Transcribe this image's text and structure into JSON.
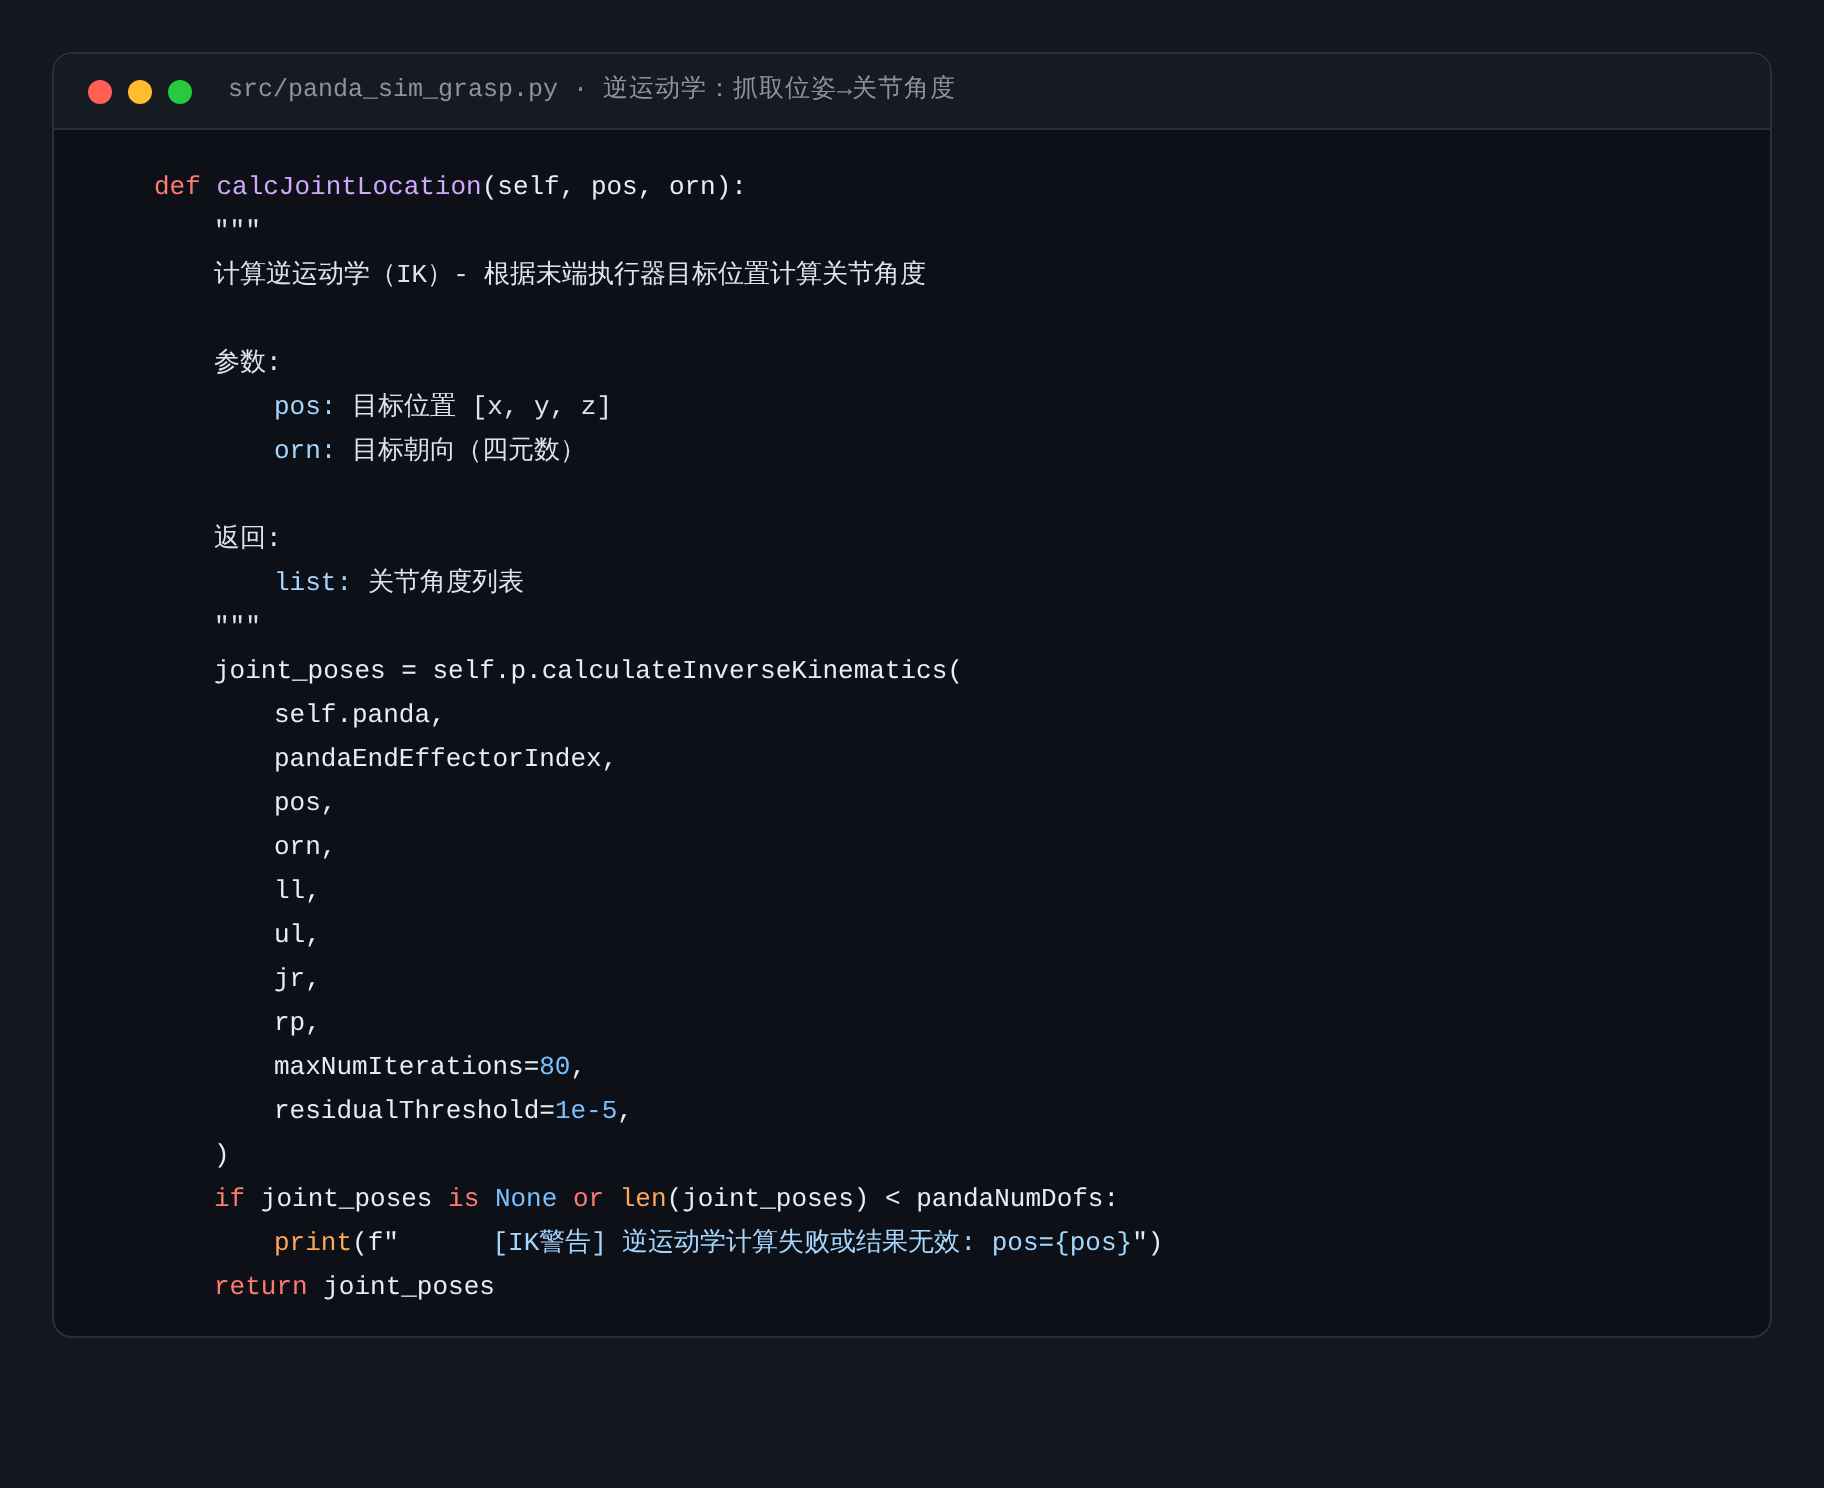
{
  "window": {
    "title": "src/panda_sim_grasp.py · 逆运动学：抓取位姿→关节角度"
  },
  "code": [
    {
      "kind": "code",
      "tokens": [
        {
          "kind": "kw",
          "text": "def "
        },
        {
          "kind": "fn",
          "text": "calcJointLocation"
        },
        {
          "kind": "plain",
          "text": "(self, pos, orn):"
        }
      ],
      "children": [
        {
          "kind": "code",
          "tokens": [
            {
              "kind": "doc",
              "text": "\"\"\""
            }
          ]
        },
        {
          "kind": "code",
          "tokens": [
            {
              "kind": "doc",
              "text": "计算逆运动学（IK）- 根据末端执行器目标位置计算关节角度"
            }
          ]
        },
        {
          "kind": "blank"
        },
        {
          "kind": "code",
          "tokens": [
            {
              "kind": "doc",
              "text": "参数:"
            }
          ],
          "children": [
            {
              "kind": "code",
              "tokens": [
                {
                  "kind": "param",
                  "text": "pos:"
                },
                {
                  "kind": "doc",
                  "text": " 目标位置 [x, y, z]"
                }
              ]
            },
            {
              "kind": "code",
              "tokens": [
                {
                  "kind": "param",
                  "text": "orn:"
                },
                {
                  "kind": "doc",
                  "text": " 目标朝向（四元数）"
                }
              ]
            }
          ]
        },
        {
          "kind": "blank"
        },
        {
          "kind": "code",
          "tokens": [
            {
              "kind": "doc",
              "text": "返回:"
            }
          ],
          "children": [
            {
              "kind": "code",
              "tokens": [
                {
                  "kind": "param",
                  "text": "list:"
                },
                {
                  "kind": "doc",
                  "text": " 关节角度列表"
                }
              ]
            }
          ]
        },
        {
          "kind": "code",
          "tokens": [
            {
              "kind": "doc",
              "text": "\"\"\""
            }
          ]
        },
        {
          "kind": "code",
          "tokens": [
            {
              "kind": "plain",
              "text": "joint_poses = self.p.calculateInverseKinematics("
            }
          ],
          "children": [
            {
              "kind": "code",
              "tokens": [
                {
                  "kind": "plain",
                  "text": "self.panda,"
                }
              ]
            },
            {
              "kind": "code",
              "tokens": [
                {
                  "kind": "plain",
                  "text": "pandaEndEffectorIndex,"
                }
              ]
            },
            {
              "kind": "code",
              "tokens": [
                {
                  "kind": "plain",
                  "text": "pos,"
                }
              ]
            },
            {
              "kind": "code",
              "tokens": [
                {
                  "kind": "plain",
                  "text": "orn,"
                }
              ]
            },
            {
              "kind": "code",
              "tokens": [
                {
                  "kind": "plain",
                  "text": "ll,"
                }
              ]
            },
            {
              "kind": "code",
              "tokens": [
                {
                  "kind": "plain",
                  "text": "ul,"
                }
              ]
            },
            {
              "kind": "code",
              "tokens": [
                {
                  "kind": "plain",
                  "text": "jr,"
                }
              ]
            },
            {
              "kind": "code",
              "tokens": [
                {
                  "kind": "plain",
                  "text": "rp,"
                }
              ]
            },
            {
              "kind": "code",
              "tokens": [
                {
                  "kind": "plain",
                  "text": "maxNumIterations="
                },
                {
                  "kind": "num",
                  "text": "80"
                },
                {
                  "kind": "plain",
                  "text": ","
                }
              ]
            },
            {
              "kind": "code",
              "tokens": [
                {
                  "kind": "plain",
                  "text": "residualThreshold="
                },
                {
                  "kind": "num",
                  "text": "1e-5"
                },
                {
                  "kind": "plain",
                  "text": ","
                }
              ]
            }
          ]
        },
        {
          "kind": "code",
          "tokens": [
            {
              "kind": "plain",
              "text": ")"
            }
          ]
        },
        {
          "kind": "code",
          "tokens": [
            {
              "kind": "kw",
              "text": "if"
            },
            {
              "kind": "plain",
              "text": " joint_poses "
            },
            {
              "kind": "kw",
              "text": "is "
            },
            {
              "kind": "num",
              "text": "None"
            },
            {
              "kind": "kw",
              "text": " or "
            },
            {
              "kind": "builtin",
              "text": "len"
            },
            {
              "kind": "plain",
              "text": "(joint_poses) < pandaNumDofs:"
            }
          ],
          "children": [
            {
              "kind": "code",
              "tokens": [
                {
                  "kind": "builtin",
                  "text": "print"
                },
                {
                  "kind": "plain",
                  "text": "(f\"      "
                },
                {
                  "kind": "str",
                  "text": "[IK警告] 逆运动学计算失败或结果无效: pos={pos}"
                },
                {
                  "kind": "plain",
                  "text": "\")"
                }
              ]
            }
          ]
        },
        {
          "kind": "code",
          "tokens": [
            {
              "kind": "kw",
              "text": "return"
            },
            {
              "kind": "plain",
              "text": " joint_poses"
            }
          ]
        }
      ]
    }
  ]
}
